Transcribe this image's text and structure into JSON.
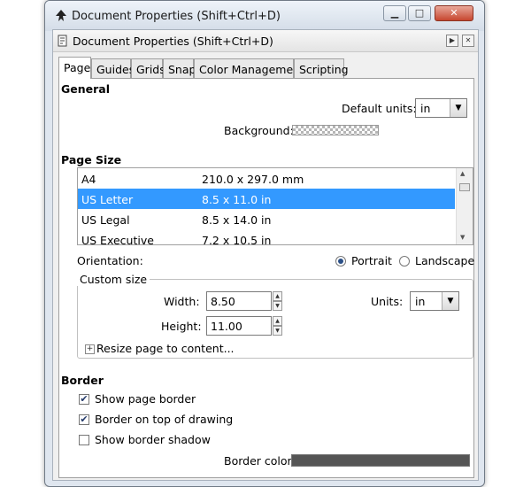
{
  "window": {
    "title": "Document Properties (Shift+Ctrl+D)",
    "min_glyph": "▁",
    "max_glyph": "□",
    "close_glyph": "✕"
  },
  "dock": {
    "title": "Document Properties (Shift+Ctrl+D)",
    "float_glyph": "▶",
    "close_glyph": "✕"
  },
  "tabs": [
    "Page",
    "Guides",
    "Grids",
    "Snap",
    "Color Management",
    "Scripting"
  ],
  "general": {
    "heading": "General",
    "default_units_label": "Default units:",
    "default_units_value": "in",
    "background_label": "Background:"
  },
  "page_size": {
    "heading": "Page Size",
    "rows": [
      {
        "name": "A4",
        "size": "210.0 x 297.0 mm"
      },
      {
        "name": "US Letter",
        "size": "8.5 x 11.0 in"
      },
      {
        "name": "US Legal",
        "size": "8.5 x 14.0 in"
      },
      {
        "name": "US Executive",
        "size": "7.2 x 10.5 in"
      }
    ],
    "selected_index": 1,
    "orientation_label": "Orientation:",
    "portrait_label": "Portrait",
    "landscape_label": "Landscape",
    "orientation_selected": "Portrait"
  },
  "custom_size": {
    "title": "Custom size",
    "width_label": "Width:",
    "width_value": "8.50",
    "height_label": "Height:",
    "height_value": "11.00",
    "units_label": "Units:",
    "units_value": "in",
    "resize_label": "Resize page to content..."
  },
  "border": {
    "heading": "Border",
    "show_page_border": {
      "label": "Show page border",
      "checked": true
    },
    "border_on_top": {
      "label": "Border on top of drawing",
      "checked": true
    },
    "show_border_shadow": {
      "label": "Show border shadow",
      "checked": false
    },
    "border_color_label": "Border color:",
    "border_color": "#555555"
  },
  "colors": {
    "selection": "#3399ff"
  }
}
